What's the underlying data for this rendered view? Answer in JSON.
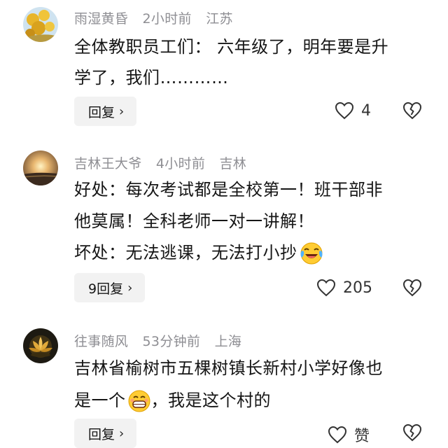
{
  "comments": [
    {
      "username": "雨湿黄昏",
      "time": "2小时前",
      "location": "江苏",
      "text_lines": [
        "全体教职员工们： 六年级了，明年要是升",
        "学了，我们…………"
      ],
      "reply_label": "回复",
      "like_count": "4",
      "avatar_icon": "yellow-flowers-avatar"
    },
    {
      "username": "吉林王大爷",
      "time": "4小时前",
      "location": "吉林",
      "text_lines": [
        "好处：每次考试都是全校第一！班干部非",
        "他莫属！全科老师一对一讲解！",
        "坏处：无法逃课，无法打小抄"
      ],
      "reply_label": "9回复",
      "like_count": "205",
      "avatar_icon": "sunset-avatar",
      "emoji": "laugh-cry-emoji"
    },
    {
      "username": "往事随风",
      "time": "53分钟前",
      "location": "上海",
      "text_lines": [
        "吉林省榆树市五棵树镇长新村小学好像也",
        "是一个",
        "，我是这个村的"
      ],
      "reply_label": "回复",
      "like_count": "赞",
      "avatar_icon": "lotus-avatar",
      "emoji": "grin-emoji"
    }
  ]
}
